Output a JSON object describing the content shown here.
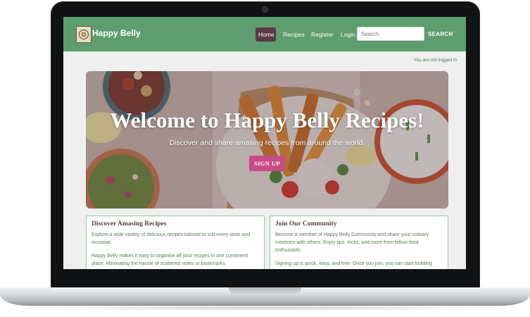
{
  "navbar": {
    "brand": "Happy Belly",
    "items": [
      {
        "label": "Home",
        "active": true
      },
      {
        "label": "Recipes"
      },
      {
        "label": "Register"
      },
      {
        "label": "Login"
      }
    ],
    "search_placeholder": "Search",
    "search_button": "SEARCH"
  },
  "login_status": "You are not logged in",
  "hero": {
    "title": "Welcome to Happy Belly Recipes!",
    "subtitle": "Discover and share amasing recipes from around the world.",
    "button": "SIGN UP"
  },
  "cards": [
    {
      "title": "Discover Amasing Recipes",
      "paragraphs": [
        "Explore a wide variety of delicious recipes tailored to suit every taste and occasion.",
        "Happy Belly makes it easy to organise all your recipes in one convinient place, eliminating the hassle of scattered notes or bookmarks."
      ]
    },
    {
      "title": "Join Our Community",
      "paragraphs": [
        "Become a member of Happy Belly Community and share your culinary creations with others. Enjoy tips, tricks, and more from fellow food enthusiasts.",
        "Signing up is quick, easy, and free. Once you join, you can start building"
      ]
    }
  ],
  "colors": {
    "navbar": "#5e9d6d",
    "active_nav": "#5b3548",
    "signup_button": "#c84c86",
    "card_border": "#9cc3a2",
    "body_text": "#587d57"
  }
}
